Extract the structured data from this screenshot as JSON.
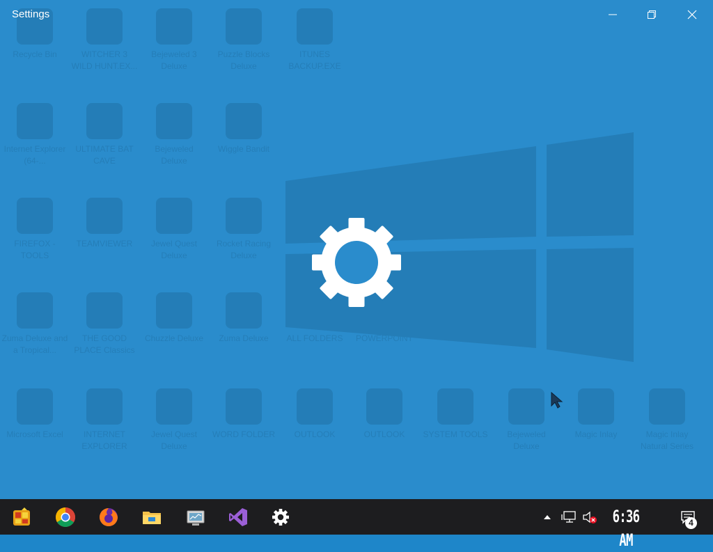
{
  "window": {
    "title": "Settings",
    "controls": {
      "minimize_icon": "minimize-icon",
      "maximize_icon": "restore-icon",
      "close_icon": "close-icon"
    },
    "splash_icon": "gear-icon",
    "background_color": "#2a8ccc"
  },
  "desktop_ghost_icons": [
    {
      "label": "Recycle Bin"
    },
    {
      "label": "WITCHER 3 WILD HUNT.EX..."
    },
    {
      "label": "Bejeweled 3 Deluxe"
    },
    {
      "label": "Puzzle Blocks Deluxe"
    },
    {
      "label": "ITUNES BACKUP.EXE"
    },
    {
      "label": "Internet Explorer (64-..."
    },
    {
      "label": "ULTIMATE BAT CAVE"
    },
    {
      "label": "Bejeweled Deluxe"
    },
    {
      "label": "Wiggle Bandit"
    },
    {
      "label": "FIREFOX - TOOLS"
    },
    {
      "label": "TEAMVIEWER"
    },
    {
      "label": "Jewel Quest Deluxe"
    },
    {
      "label": "Rocket Racing Deluxe"
    },
    {
      "label": "Zuma Deluxe and a Tropical..."
    },
    {
      "label": "THE GOOD PLACE Classics"
    },
    {
      "label": "Chuzzle Deluxe"
    },
    {
      "label": "Zuma Deluxe"
    },
    {
      "label": "ALL FOLDERS"
    },
    {
      "label": "POWERPOINT"
    },
    {
      "label": "Microsoft Excel"
    },
    {
      "label": "INTERNET EXPLORER"
    },
    {
      "label": "Jewel Quest Deluxe"
    },
    {
      "label": "WORD FOLDER"
    },
    {
      "label": "OUTLOOK"
    },
    {
      "label": "OUTLOOK"
    },
    {
      "label": "SYSTEM TOOLS"
    },
    {
      "label": "Bejeweled Deluxe"
    },
    {
      "label": "Magic Inlay"
    },
    {
      "label": "Magic Inlay Natural Series"
    }
  ],
  "taskbar": {
    "apps": [
      {
        "name": "puzzle-app-icon"
      },
      {
        "name": "chrome-icon"
      },
      {
        "name": "firefox-icon"
      },
      {
        "name": "file-explorer-icon"
      },
      {
        "name": "remote-desktop-icon"
      },
      {
        "name": "visual-studio-icon"
      },
      {
        "name": "settings-icon"
      }
    ],
    "tray": {
      "overflow_icon": "chevron-up-icon",
      "network_icon": "network-icon",
      "volume_icon": "volume-muted-icon",
      "clock": "6:36 AM",
      "notification_icon": "action-center-icon",
      "notification_count": "4"
    },
    "background_color": "#1d1d1f"
  }
}
